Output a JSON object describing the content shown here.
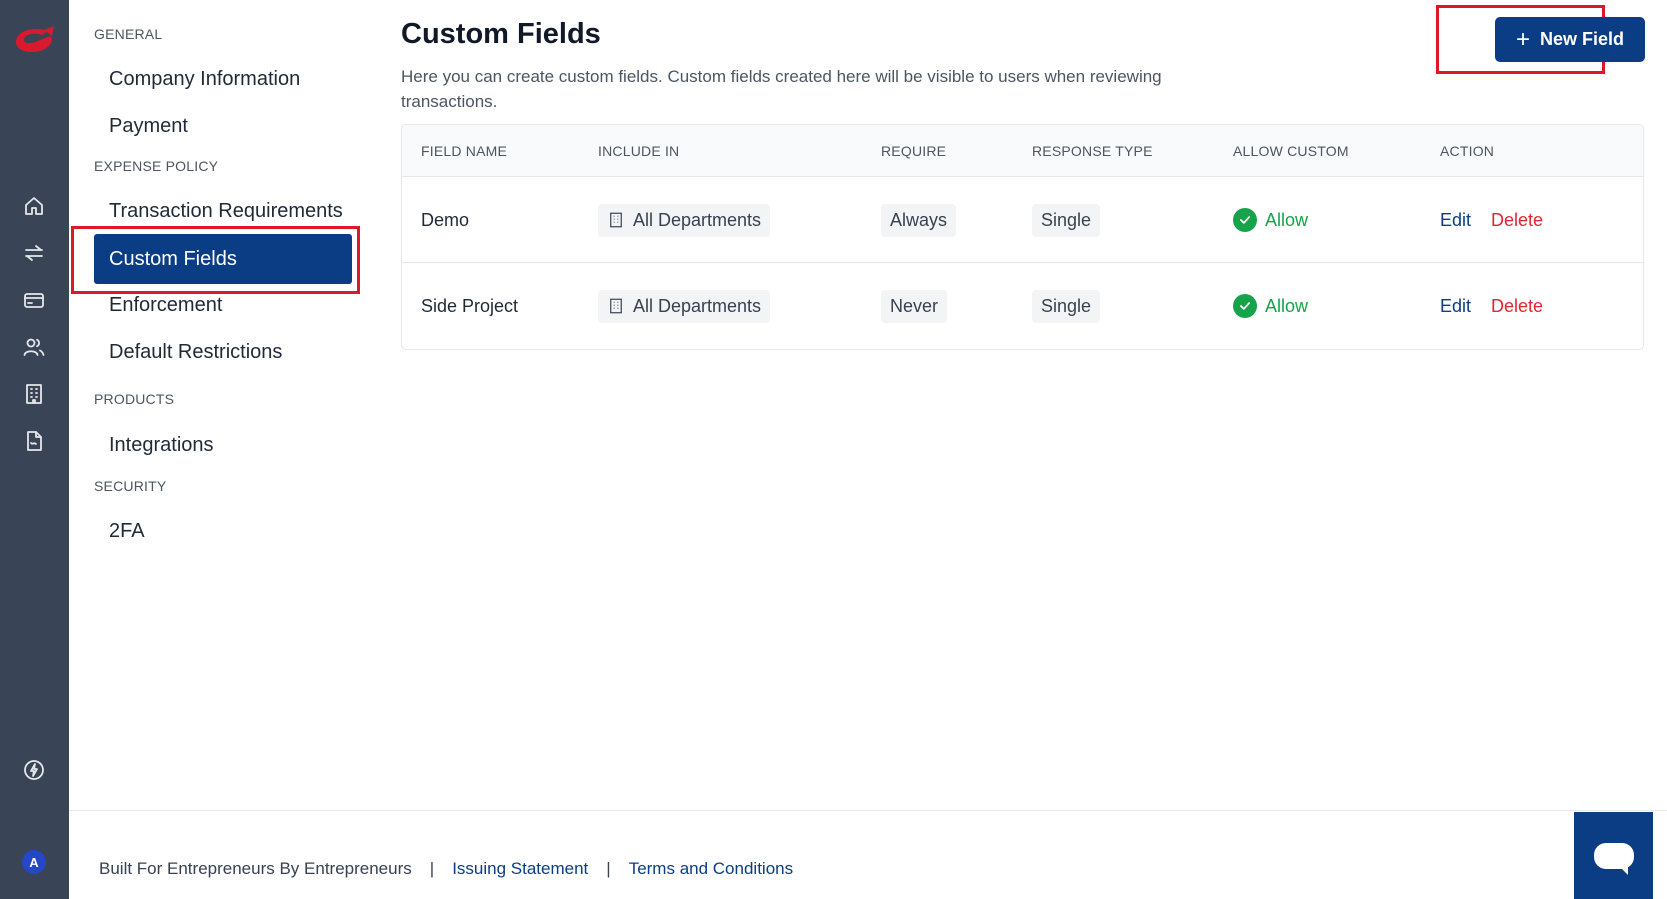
{
  "rail": {
    "icons": [
      "home-icon",
      "transfer-icon",
      "card-icon",
      "users-icon",
      "building-icon",
      "document-icon",
      "lightning-icon"
    ],
    "avatar_initial": "A"
  },
  "settings_nav": {
    "sections": [
      {
        "title": "GENERAL",
        "items": [
          "Company Information",
          "Payment"
        ]
      },
      {
        "title": "EXPENSE POLICY",
        "items": [
          "Transaction Requirements",
          "Custom Fields",
          "Enforcement",
          "Default Restrictions"
        ]
      },
      {
        "title": "PRODUCTS",
        "items": [
          "Integrations"
        ]
      },
      {
        "title": "SECURITY",
        "items": [
          "2FA"
        ]
      }
    ],
    "active_item": "Custom Fields"
  },
  "main": {
    "title": "Custom Fields",
    "description": "Here you can create custom fields. Custom fields created here will be visible to users when reviewing transactions.",
    "new_button_label": "New Field"
  },
  "table": {
    "columns": [
      "FIELD NAME",
      "INCLUDE IN",
      "REQUIRE",
      "RESPONSE TYPE",
      "ALLOW CUSTOM",
      "ACTION"
    ],
    "rows": [
      {
        "field_name": "Demo",
        "include_in": "All Departments",
        "require": "Always",
        "response_type": "Single",
        "allow_custom": "Allow",
        "edit": "Edit",
        "delete": "Delete"
      },
      {
        "field_name": "Side Project",
        "include_in": "All Departments",
        "require": "Never",
        "response_type": "Single",
        "allow_custom": "Allow",
        "edit": "Edit",
        "delete": "Delete"
      }
    ]
  },
  "footer": {
    "tagline": "Built For Entrepreneurs By Entrepreneurs",
    "separator": "|",
    "link_issuing": "Issuing Statement",
    "link_terms": "Terms and Conditions"
  },
  "colors": {
    "rail_bg": "#394457",
    "primary": "#0b3d84",
    "success": "#16a34a",
    "danger": "#e02434",
    "highlight": "#e0162b",
    "brand_logo": "#d9192e"
  }
}
